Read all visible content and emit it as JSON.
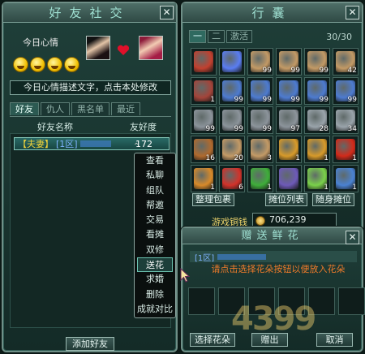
{
  "friends_panel": {
    "title": "好友社交",
    "mood_label": "今日心情",
    "mood_text": "今日心情描述文字，点击本处修改",
    "tabs": [
      "好友",
      "仇人",
      "黑名单",
      "最近"
    ],
    "col_name": "好友名称",
    "col_intimacy": "友好度",
    "rows": [
      {
        "tag": "【夫妻】",
        "server": "[1区]",
        "intimacy": "172"
      }
    ],
    "add_button": "添加好友"
  },
  "context_menu": {
    "items": [
      "查看",
      "私聊",
      "组队",
      "帮邀",
      "交易",
      "看摊",
      "双修",
      "送花",
      "求婚",
      "删除",
      "成就对比"
    ],
    "highlighted_index": 7
  },
  "bag_panel": {
    "title": "行囊",
    "tabs": [
      "一",
      "二",
      "激活"
    ],
    "capacity": "30/30",
    "slots": [
      {
        "icon": "red-box-icon",
        "color": "#c2402f",
        "count": ""
      },
      {
        "icon": "blue-orb-icon",
        "color": "#5a7df2",
        "count": ""
      },
      {
        "icon": "flute-icon",
        "color": "#c39a66",
        "count": "99"
      },
      {
        "icon": "flute-icon",
        "color": "#c39a66",
        "count": "99"
      },
      {
        "icon": "flute-icon",
        "color": "#c39a66",
        "count": "99"
      },
      {
        "icon": "flute-icon",
        "color": "#c39a66",
        "count": "42"
      },
      {
        "icon": "red-bag-icon",
        "color": "#a3443a",
        "count": "1"
      },
      {
        "icon": "blue-crossbow-icon",
        "color": "#4d7bd0",
        "count": "99"
      },
      {
        "icon": "blue-crossbow-icon",
        "color": "#4d7bd0",
        "count": "99"
      },
      {
        "icon": "blue-crossbow-icon",
        "color": "#4d7bd0",
        "count": "99"
      },
      {
        "icon": "blue-crossbow-icon",
        "color": "#4d7bd0",
        "count": "99"
      },
      {
        "icon": "blue-crossbow-icon",
        "color": "#4d7bd0",
        "count": "99"
      },
      {
        "icon": "grey-crossbow-icon",
        "color": "#8c949b",
        "count": "99"
      },
      {
        "icon": "grey-crossbow-icon",
        "color": "#8c949b",
        "count": "99"
      },
      {
        "icon": "grey-crossbow-icon",
        "color": "#8c949b",
        "count": "99"
      },
      {
        "icon": "grey-crossbow-icon",
        "color": "#8c949b",
        "count": "97"
      },
      {
        "icon": "pen-icon",
        "color": "#9aa4ab",
        "count": "28"
      },
      {
        "icon": "pen-icon",
        "color": "#9aa4ab",
        "count": "34"
      },
      {
        "icon": "gourd-icon",
        "color": "#b06a2e",
        "count": "16"
      },
      {
        "icon": "flute-icon",
        "color": "#c39a66",
        "count": "20"
      },
      {
        "icon": "flute-icon",
        "color": "#c39a66",
        "count": "3"
      },
      {
        "icon": "claw-icon",
        "color": "#d79a2a",
        "count": "1"
      },
      {
        "icon": "claw-icon",
        "color": "#d79a2a",
        "count": "1"
      },
      {
        "icon": "red-orb-icon",
        "color": "#d22a1a",
        "count": "1"
      },
      {
        "icon": "torch-icon",
        "color": "#d88a2a",
        "count": "1"
      },
      {
        "icon": "red-potion-icon",
        "color": "#d2322a",
        "count": "6"
      },
      {
        "icon": "green-staff-icon",
        "color": "#3fae3a",
        "count": "1"
      },
      {
        "icon": "purple-gem-icon",
        "color": "#6d5ab8",
        "count": ""
      },
      {
        "icon": "green-sword-icon",
        "color": "#7ad14a",
        "count": "1"
      },
      {
        "icon": "blue-wand-icon",
        "color": "#4a82d2",
        "count": "1"
      }
    ],
    "btn_sort": "整理包裹",
    "btn_stall_list": "摊位列表",
    "btn_stall": "随身摊位",
    "money_label": "游戏铜钱",
    "money_value": "706,239"
  },
  "flower_panel": {
    "title": "赠送鲜花",
    "target_server": "[1区]",
    "hint": "请点击选择花朵按钮以便放入花朵",
    "btn_select": "选择花朵",
    "btn_give": "赠出",
    "btn_cancel": "取消"
  },
  "watermark": "4399"
}
